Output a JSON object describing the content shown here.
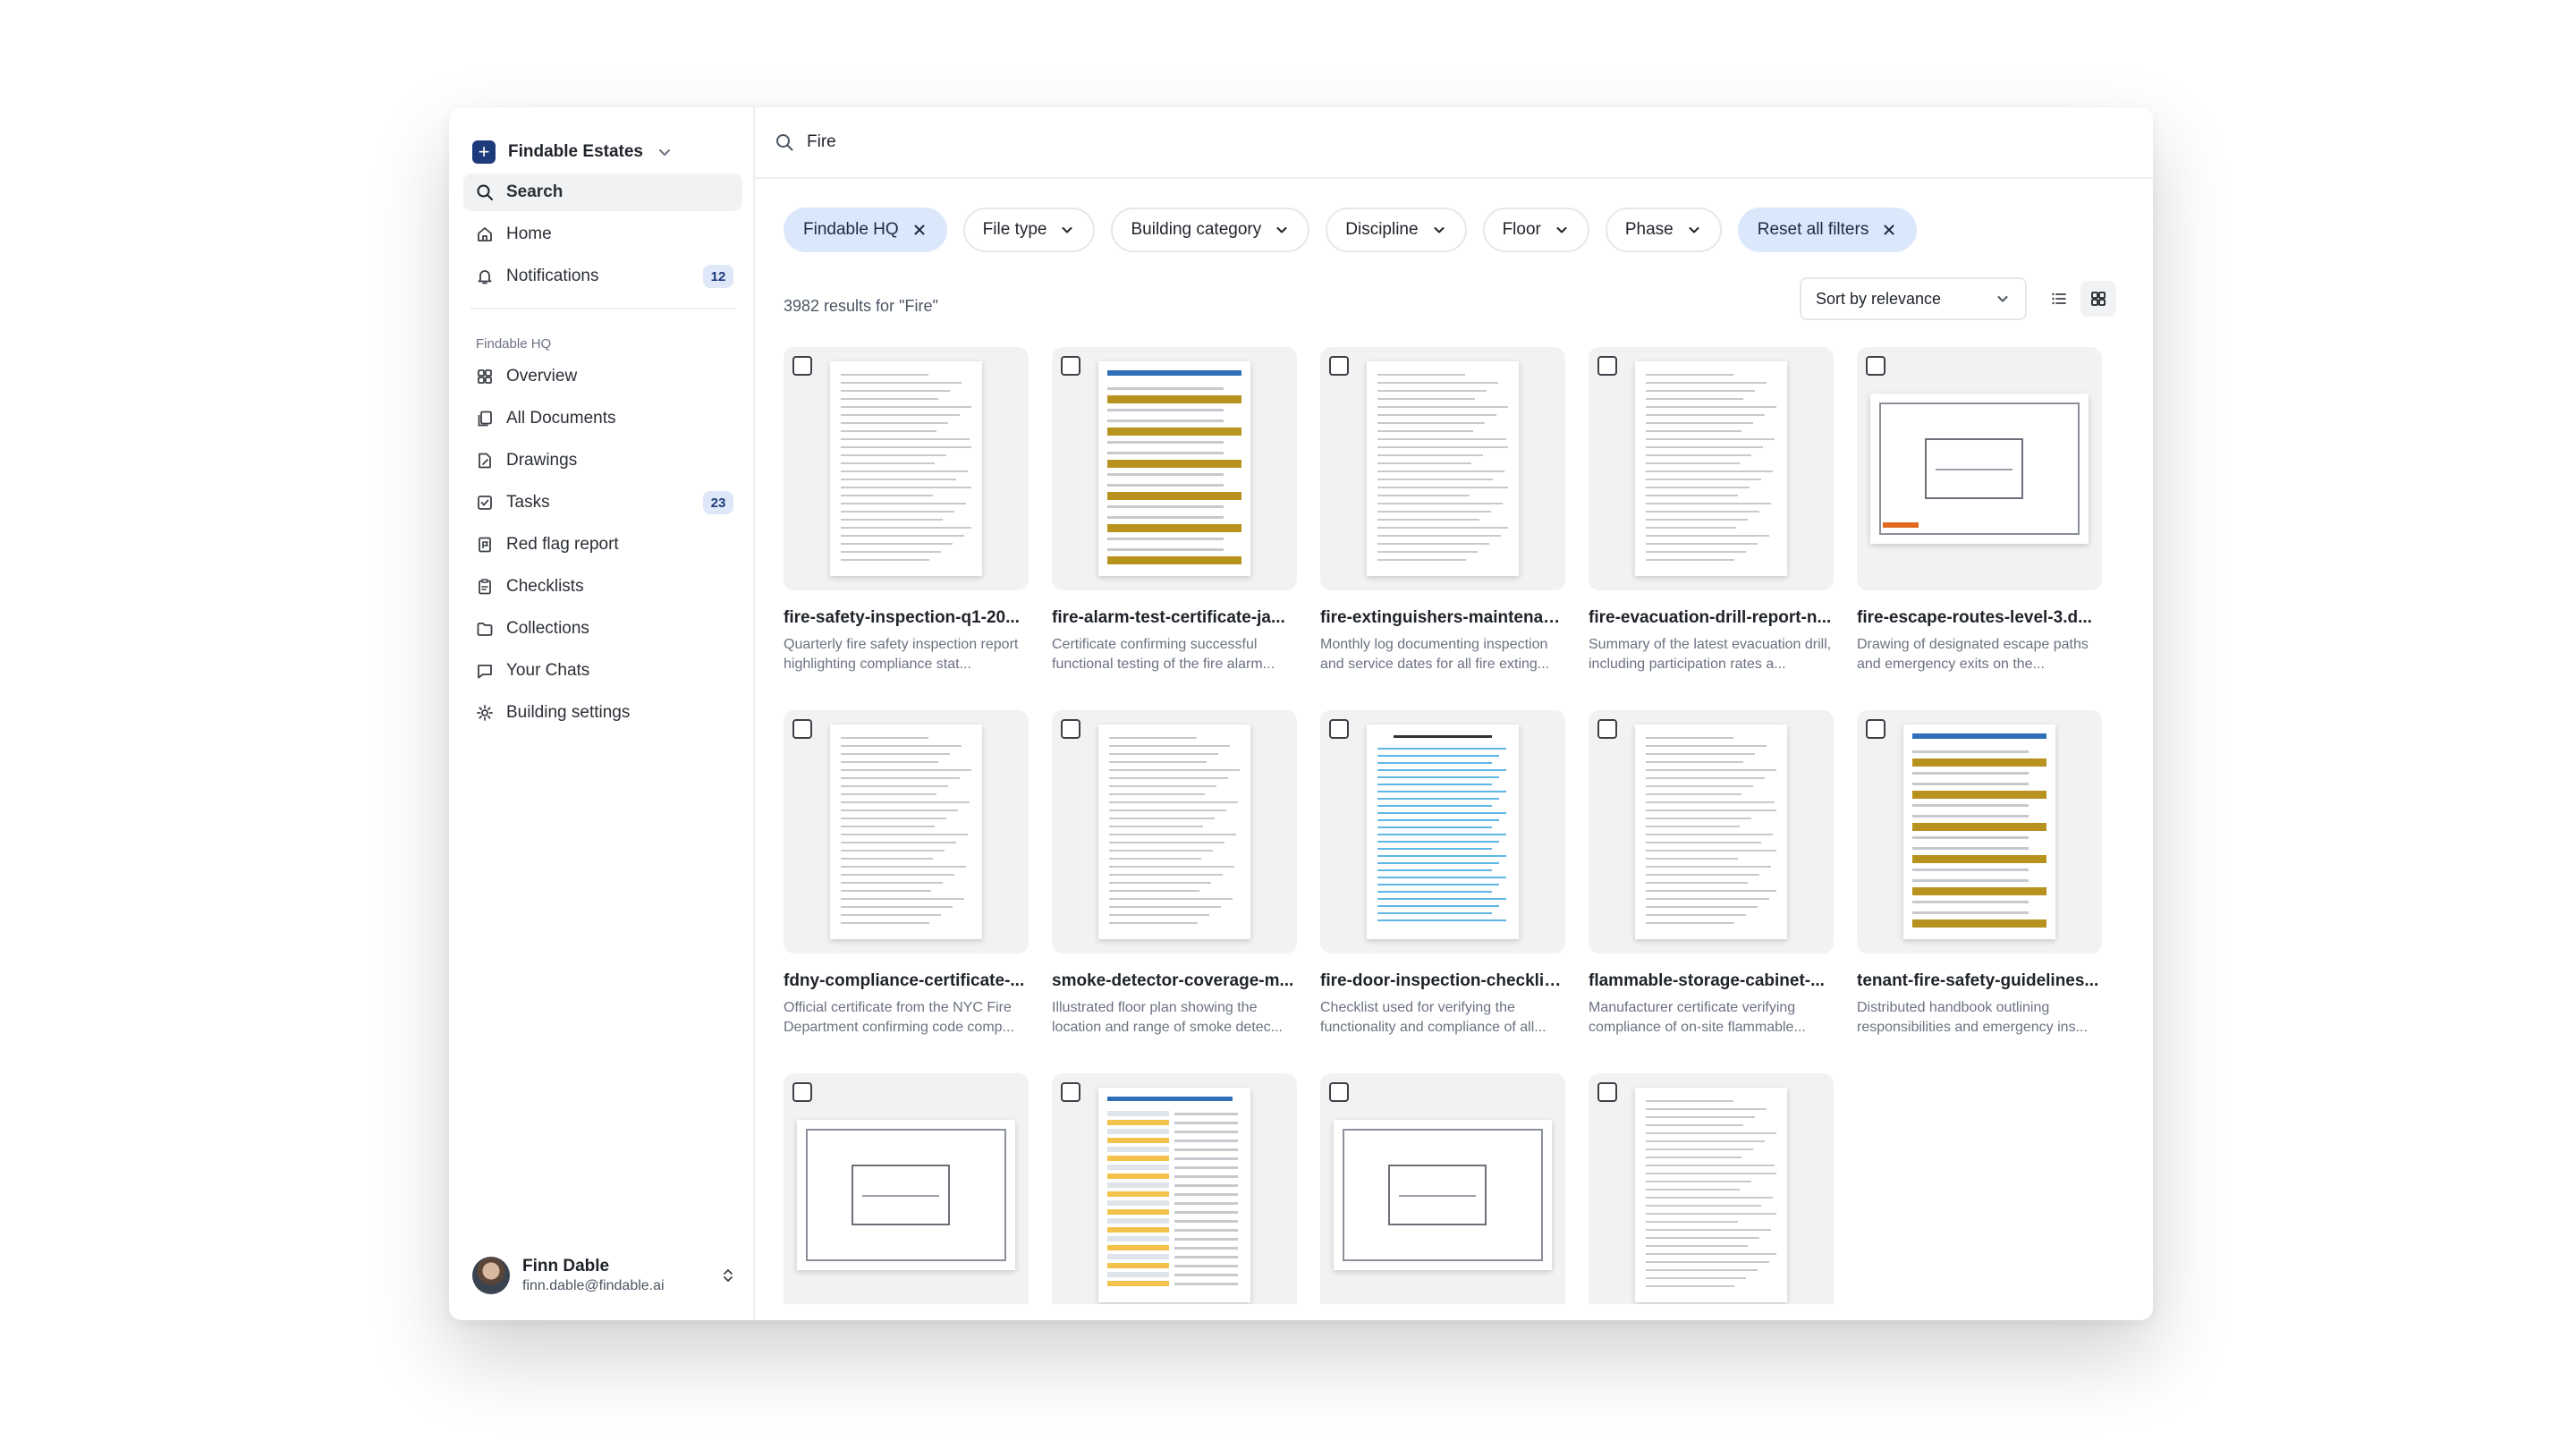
{
  "workspace": {
    "name": "Findable Estates"
  },
  "search": {
    "value": "Fire"
  },
  "nav": {
    "search": "Search",
    "home": "Home",
    "notifications": "Notifications",
    "notifications_count": "12",
    "section_title": "Findable HQ",
    "overview": "Overview",
    "all_documents": "All Documents",
    "drawings": "Drawings",
    "tasks": "Tasks",
    "tasks_count": "23",
    "red_flag_report": "Red flag report",
    "checklists": "Checklists",
    "collections": "Collections",
    "your_chats": "Your Chats",
    "building_settings": "Building settings"
  },
  "user": {
    "name": "Finn Dable",
    "email": "finn.dable@findable.ai"
  },
  "filters": {
    "findable_hq": "Findable HQ",
    "file_type": "File type",
    "building_category": "Building category",
    "discipline": "Discipline",
    "floor": "Floor",
    "phase": "Phase",
    "reset": "Reset all filters"
  },
  "results": {
    "count_text": "3982 results for \"Fire\""
  },
  "sort": {
    "label": "Sort by relevance"
  },
  "colors": {
    "accent": "#1d3a7a",
    "chip_selected": "#dbe7fb",
    "band_gold": "#b8921f"
  },
  "documents": [
    {
      "title": "fire-safety-inspection-q1-20...",
      "desc": "Quarterly fire safety inspection report highlighting compliance stat..."
    },
    {
      "title": "fire-alarm-test-certificate-ja...",
      "desc": "Certificate confirming successful functional testing of the fire alarm..."
    },
    {
      "title": "fire-extinguishers-maintenan...",
      "desc": "Monthly log documenting inspection and service dates for all fire exting..."
    },
    {
      "title": "fire-evacuation-drill-report-n...",
      "desc": "Summary of the latest evacuation drill, including participation rates a..."
    },
    {
      "title": "fire-escape-routes-level-3.d...",
      "desc": "Drawing of designated escape paths and emergency exits on the..."
    },
    {
      "title": "fdny-compliance-certificate-...",
      "desc": "Official certificate from the NYC Fire Department confirming code comp..."
    },
    {
      "title": "smoke-detector-coverage-m...",
      "desc": "Illustrated floor plan showing the location and range of smoke detec..."
    },
    {
      "title": "fire-door-inspection-checklis...",
      "desc": "Checklist used for verifying the functionality and compliance of all..."
    },
    {
      "title": "flammable-storage-cabinet-...",
      "desc": "Manufacturer certificate verifying compliance of on-site flammable..."
    },
    {
      "title": "tenant-fire-safety-guidelines...",
      "desc": "Distributed handbook outlining responsibilities and emergency ins..."
    },
    {
      "title": "",
      "desc": ""
    },
    {
      "title": "",
      "desc": ""
    },
    {
      "title": "",
      "desc": ""
    },
    {
      "title": "",
      "desc": ""
    }
  ]
}
